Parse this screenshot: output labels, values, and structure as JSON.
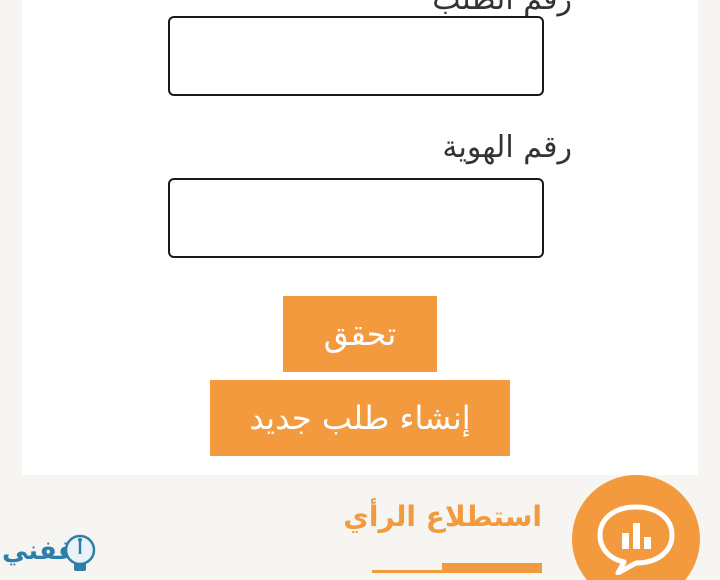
{
  "form": {
    "top_field_label": "رقم الطلب",
    "id_field_label": "رقم الهوية",
    "top_field_value": "",
    "id_field_value": "",
    "verify_button": "تحقق",
    "create_button": "إنشاء طلب جديد"
  },
  "poll": {
    "title": "استطلاع الرأي",
    "icon": "chat-bar-chart-icon"
  },
  "logo": {
    "text": "ثقفني",
    "icon": "lightbulb-icon"
  },
  "colors": {
    "accent": "#f29a3d",
    "background": "#f6f5f2",
    "card": "#ffffff",
    "logo_blue": "#2d7ea8"
  }
}
